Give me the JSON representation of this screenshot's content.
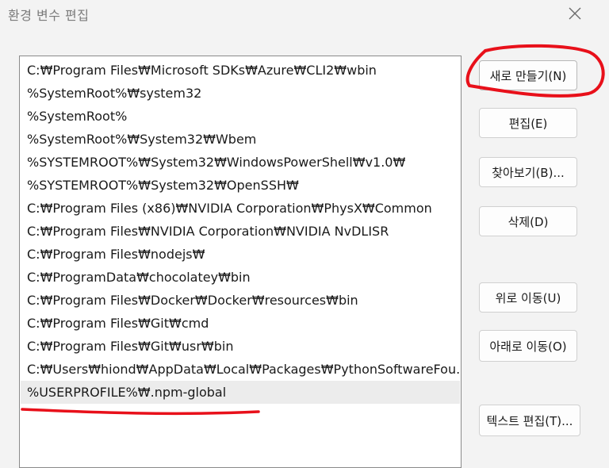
{
  "window": {
    "title": "환경 변수 편집",
    "close_icon": "close-icon"
  },
  "paths": [
    "C:₩Program Files₩Microsoft SDKs₩Azure₩CLI2₩wbin",
    "%SystemRoot%₩system32",
    "%SystemRoot%",
    "%SystemRoot%₩System32₩Wbem",
    "%SYSTEMROOT%₩System32₩WindowsPowerShell₩v1.0₩",
    "%SYSTEMROOT%₩System32₩OpenSSH₩",
    "C:₩Program Files (x86)₩NVIDIA Corporation₩PhysX₩Common",
    "C:₩Program Files₩NVIDIA Corporation₩NVIDIA NvDLISR",
    "C:₩Program Files₩nodejs₩",
    "C:₩ProgramData₩chocolatey₩bin",
    "C:₩Program Files₩Docker₩Docker₩resources₩bin",
    "C:₩Program Files₩Git₩cmd",
    "C:₩Program Files₩Git₩usr₩bin",
    "C:₩Users₩hiond₩AppData₩Local₩Packages₩PythonSoftwareFou...",
    "%USERPROFILE%₩.npm-global"
  ],
  "selected_index": 14,
  "buttons": {
    "new": "새로 만들기(N)",
    "edit": "편집(E)",
    "browse": "찾아보기(B)...",
    "delete": "삭제(D)",
    "move_up": "위로 이동(U)",
    "move_down": "아래로 이동(O)",
    "edit_text": "텍스트 편집(T)..."
  },
  "annotation_color": "#e8101a"
}
